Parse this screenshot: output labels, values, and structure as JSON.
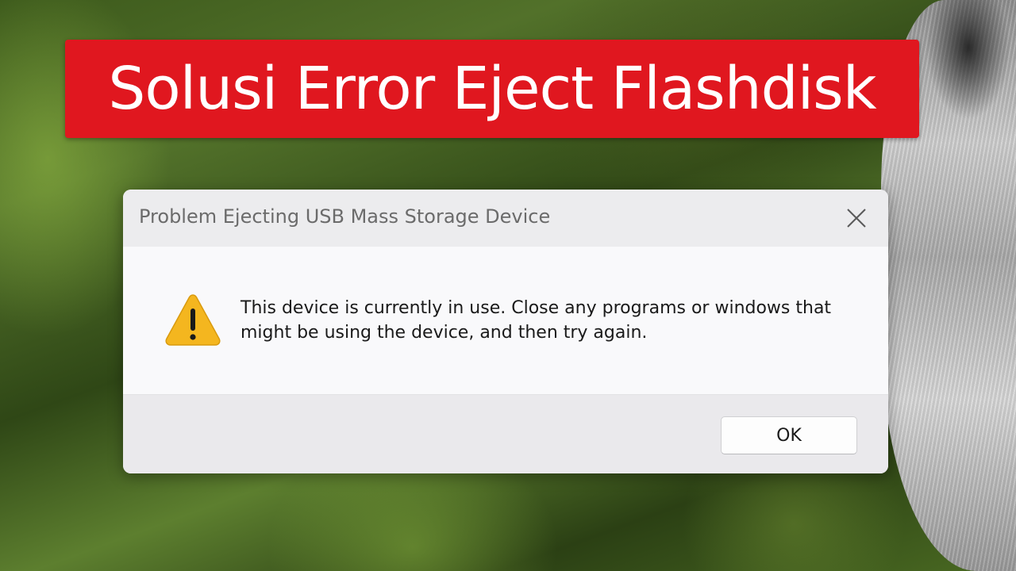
{
  "banner": {
    "text": "Solusi Error Eject Flashdisk",
    "background_color": "#e0171f",
    "text_color": "#ffffff"
  },
  "dialog": {
    "title": "Problem Ejecting USB Mass Storage Device",
    "close_icon": "close-icon",
    "status_icon": "warning-icon",
    "message": "This device is currently in use. Close any programs or windows that might be using the device, and then try again.",
    "ok_label": "OK",
    "warning_color": "#f4b61f"
  }
}
